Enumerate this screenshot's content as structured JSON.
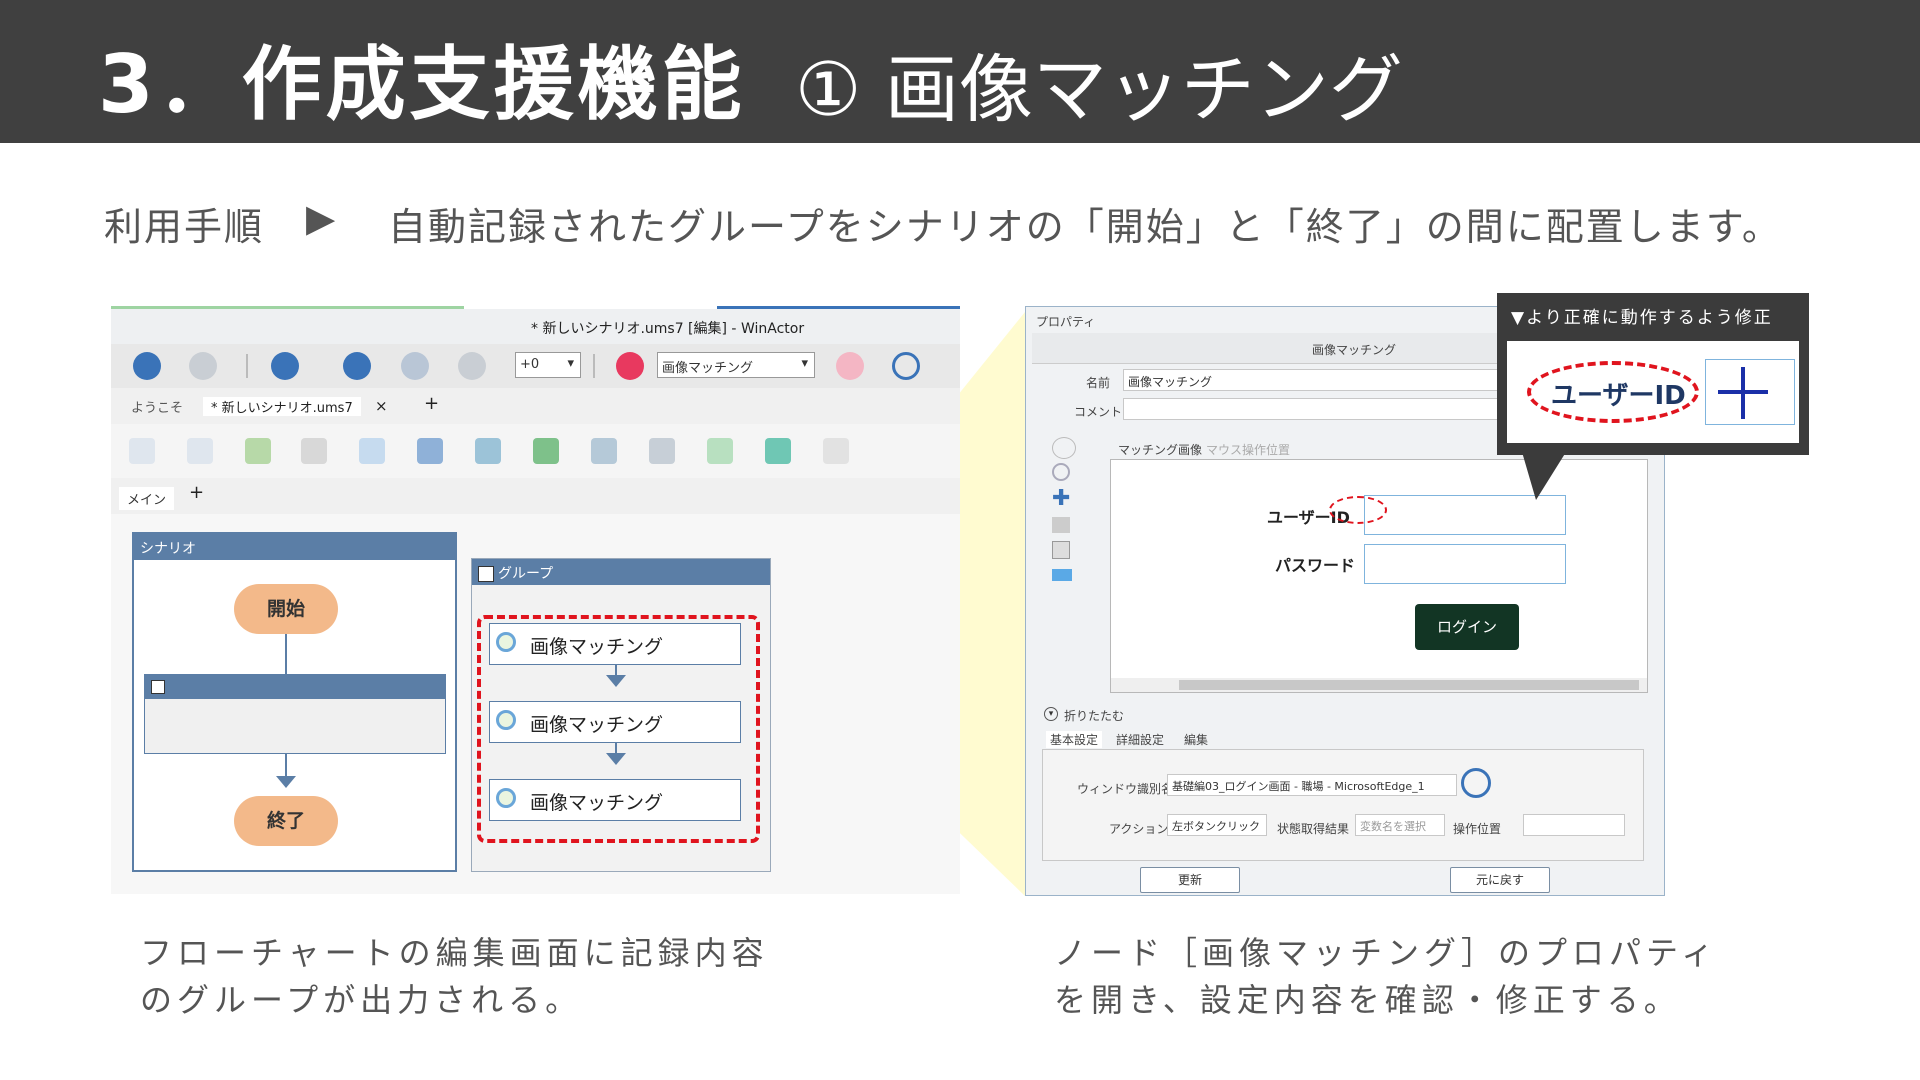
{
  "header": {
    "title": "3．作成支援機能",
    "subtitle": "① 画像マッチング"
  },
  "steps": {
    "label": "利用手順",
    "arrow": "▶",
    "text": "自動記録されたグループをシナリオの「開始」と「終了」の間に配置します。"
  },
  "captions": {
    "left": [
      "フローチャートの編集画面に記録内容",
      "のグループが出力される。"
    ],
    "right": [
      "ノード［画像マッチング］のプロパティ",
      "を開き、設定内容を確認・修正する。"
    ]
  },
  "winactor": {
    "title": "* 新しいシナリオ.ums7 [編集] - WinActor",
    "offset_value": "+0",
    "dropdown_value": "画像マッチング",
    "tabs": [
      "ようこそ",
      "* 新しいシナリオ.ums7",
      "×",
      "+"
    ],
    "main_tab": "メイン",
    "main_tab_add": "+",
    "scenario_title": "シナリオ",
    "start_label": "開始",
    "end_label": "終了",
    "group_title": "グループ",
    "nodes": [
      "画像マッチング",
      "画像マッチング",
      "画像マッチング"
    ]
  },
  "properties": {
    "window_title": "プロパティ",
    "section_title": "画像マッチング",
    "name_label": "名前",
    "name_value": "画像マッチング",
    "comment_label": "コメント",
    "subtab_image": "マッチング画像",
    "subtab_mouse": "マウス操作位置",
    "preview": {
      "userid_label": "ユーザーID",
      "password_label": "パスワード",
      "login_button": "ログイン"
    },
    "fold_label": "折りたたむ",
    "tabs": [
      "基本設定",
      "詳細設定",
      "編集"
    ],
    "window_id_label": "ウィンドウ識別名",
    "window_id_value": "基礎編03_ログイン画面 - 職場 - MicrosoftEdge_1",
    "action_label": "アクション",
    "action_value": "左ボタンクリック",
    "status_label": "状態取得結果",
    "status_value": "変数名を選択",
    "operation_pos_label": "操作位置",
    "update_button": "更新",
    "revert_button": "元に戻す"
  },
  "callout": {
    "title": "▼より正確に動作するよう修正",
    "userid_text": "ユーザーID"
  },
  "colors": {
    "header_bg": "#404040",
    "accent_red": "#e0141e",
    "node_blue": "#5b7ea6",
    "pill_orange": "#f3b98a",
    "connector_yellow": "#fffbd0"
  }
}
